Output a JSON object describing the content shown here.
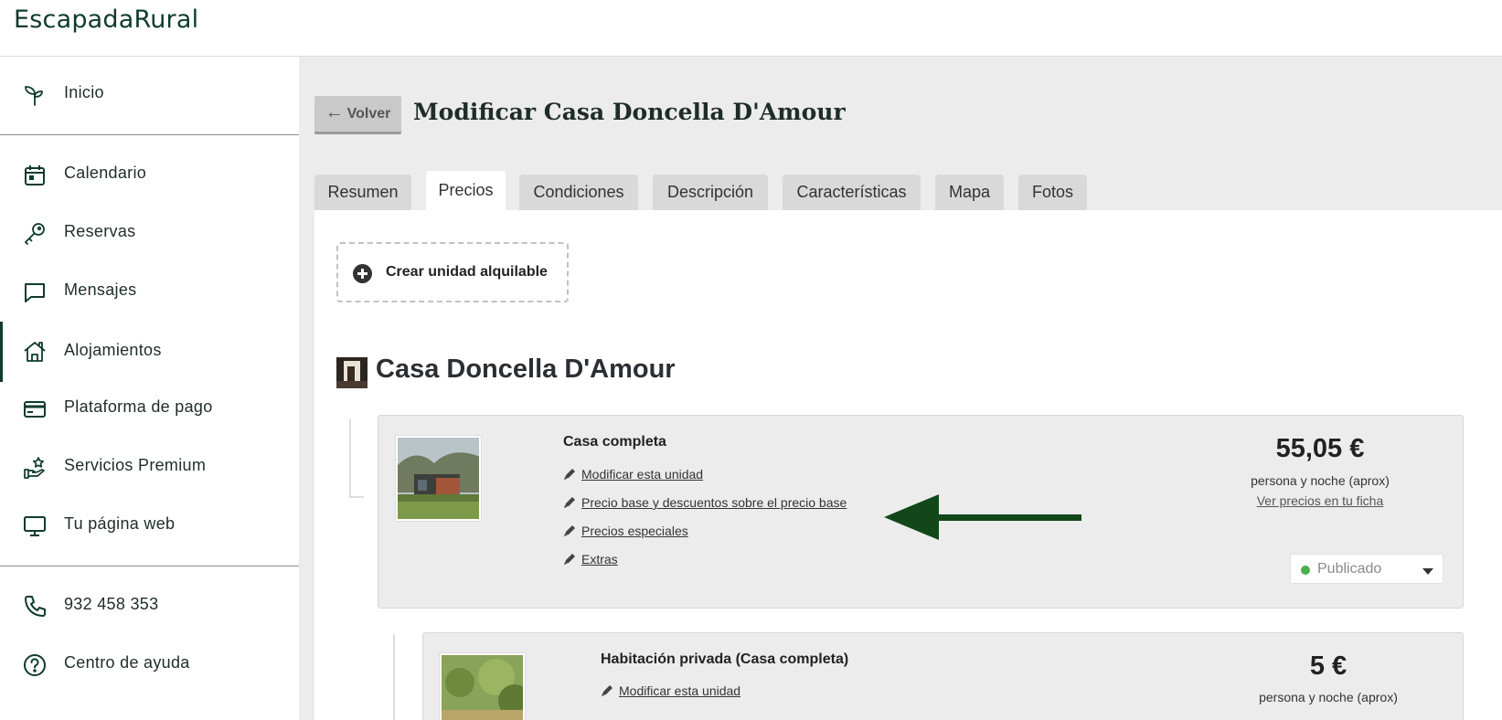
{
  "brand": {
    "logo_text": "EscapadaRural",
    "color": "#0f3b2b"
  },
  "sidebar": {
    "items": [
      {
        "label": "Inicio",
        "icon": "sprout-icon"
      },
      {
        "label": "Calendario",
        "icon": "calendar-icon"
      },
      {
        "label": "Reservas",
        "icon": "key-icon"
      },
      {
        "label": "Mensajes",
        "icon": "chat-bubble-icon"
      },
      {
        "label": "Alojamientos",
        "icon": "house-icon",
        "active": true
      },
      {
        "label": "Plataforma de pago",
        "icon": "credit-card-icon"
      },
      {
        "label": "Servicios Premium",
        "icon": "premium-hand-star-icon"
      },
      {
        "label": "Tu página web",
        "icon": "monitor-icon"
      }
    ],
    "contact": [
      {
        "label": "932 458 353",
        "icon": "phone-icon"
      },
      {
        "label": "Centro de ayuda",
        "icon": "help-circle-icon"
      }
    ]
  },
  "header": {
    "back_label": "Volver",
    "title": "Modificar Casa Doncella D'Amour"
  },
  "tabs": [
    {
      "label": "Resumen"
    },
    {
      "label": "Precios",
      "active": true
    },
    {
      "label": "Condiciones"
    },
    {
      "label": "Descripción"
    },
    {
      "label": "Características"
    },
    {
      "label": "Mapa"
    },
    {
      "label": "Fotos"
    }
  ],
  "panel": {
    "create_unit_label": "Crear unidad alquilable",
    "house_name": "Casa Doncella D'Amour",
    "units": [
      {
        "title": "Casa completa",
        "links": [
          "Modificar esta unidad",
          "Precio base y descuentos sobre el precio base",
          "Precios especiales",
          "Extras"
        ],
        "price": "55,05 €",
        "price_note": "persona y noche (aprox)",
        "price_link": "Ver precios en tu ficha",
        "status": "Publicado"
      },
      {
        "title": "Habitación privada (Casa completa)",
        "links": [
          "Modificar esta unidad"
        ],
        "price": "5 €",
        "price_note": "persona y noche (aprox)"
      }
    ]
  },
  "colors": {
    "status_published": "#4caf50",
    "annotation_arrow": "#12471a",
    "main_bg": "#ececec"
  }
}
